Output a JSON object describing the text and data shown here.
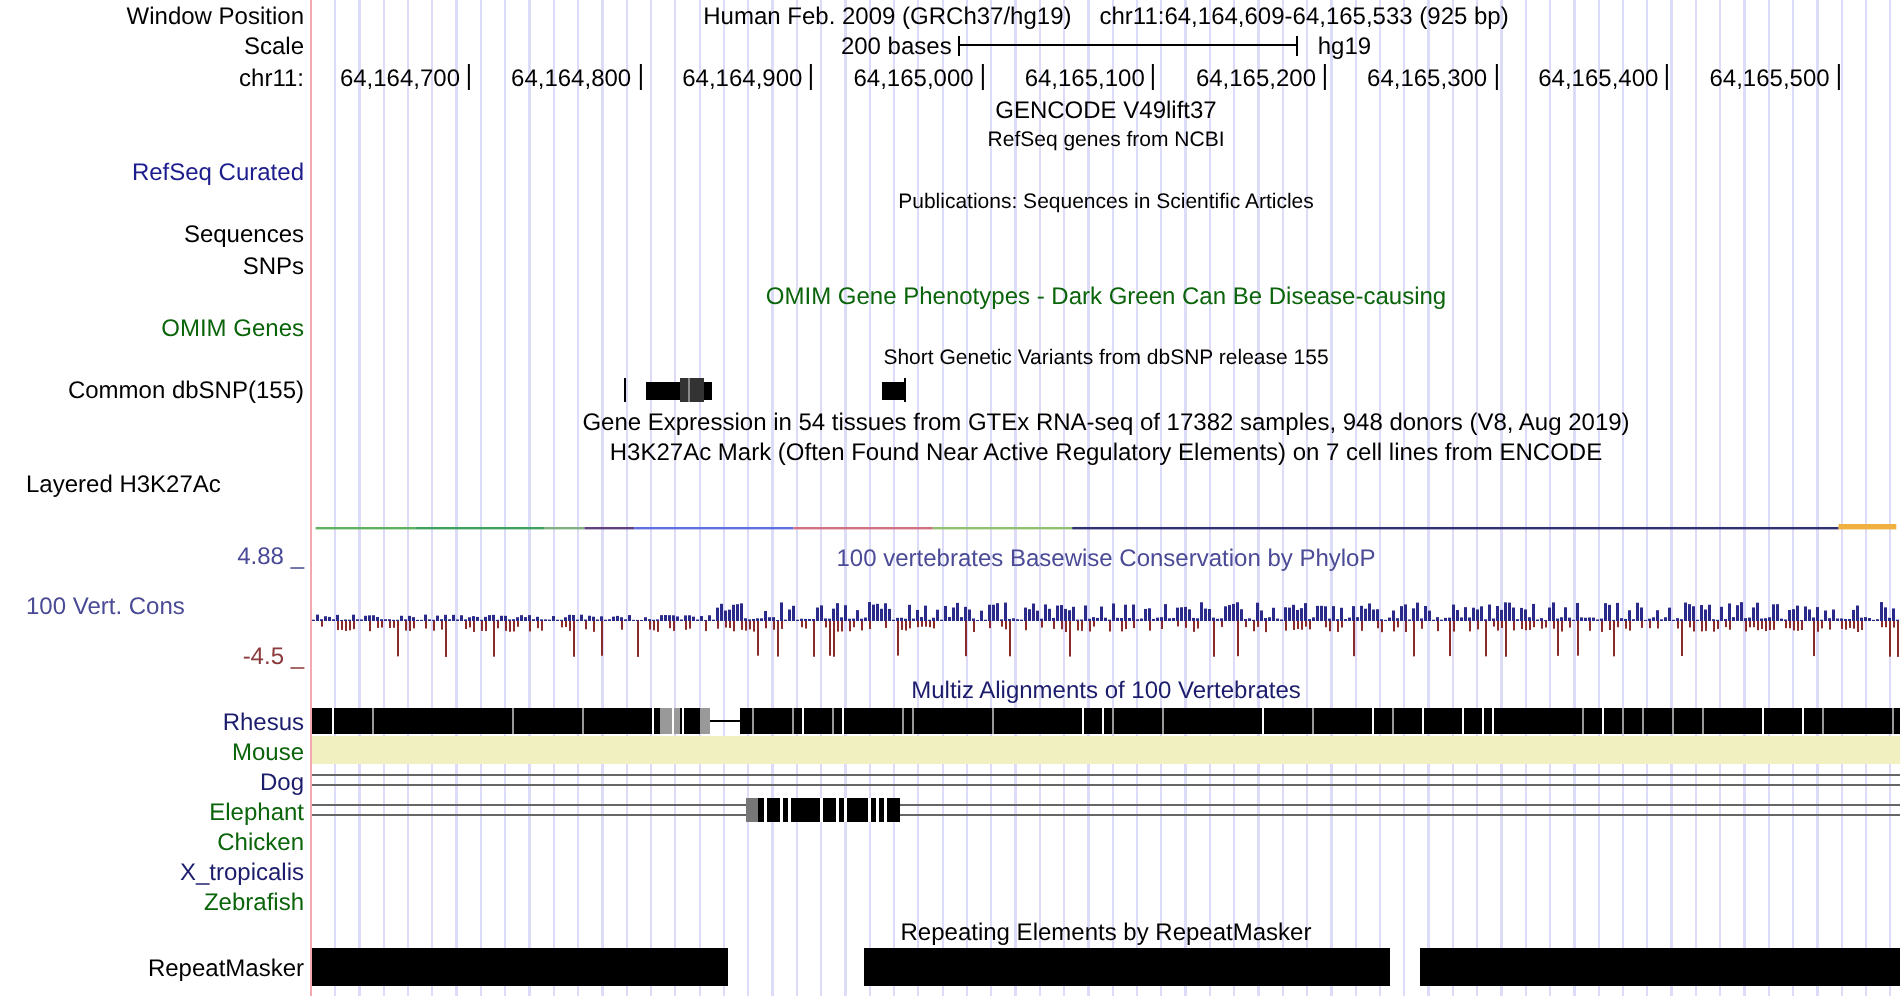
{
  "rows": [
    {
      "kind": "position",
      "label": "Window Position",
      "assembly": "Human Feb. 2009 (GRCh37/hg19)",
      "position": "chr11:64,164,609-64,165,533 (925 bp)"
    },
    {
      "kind": "scale",
      "label": "Scale",
      "span": "200 bases",
      "database": "hg19"
    },
    {
      "kind": "ruler",
      "label": "chr11:",
      "ticks": [
        "64,164,700",
        "64,164,800",
        "64,164,900",
        "64,165,000",
        "64,165,100",
        "64,165,200",
        "64,165,300",
        "64,165,400",
        "64,165,500"
      ]
    },
    {
      "kind": "title",
      "title": "GENCODE V49lift37",
      "color": "#000000"
    },
    {
      "kind": "subtitle",
      "title": "RefSeq genes from NCBI",
      "color": "#000000"
    },
    {
      "kind": "label",
      "label": "RefSeq Curated",
      "color": "#1c1c8c"
    },
    {
      "kind": "subtitle",
      "title": "Publications: Sequences in Scientific Articles",
      "color": "#000000"
    },
    {
      "kind": "label",
      "label": "Sequences",
      "color": "#000000"
    },
    {
      "kind": "label",
      "label": "SNPs",
      "color": "#000000"
    },
    {
      "kind": "title",
      "title": "OMIM Gene Phenotypes - Dark Green Can Be Disease-causing",
      "color": "#0a640a"
    },
    {
      "kind": "label",
      "label": "OMIM Genes",
      "color": "#0a640a"
    },
    {
      "kind": "subtitle",
      "title": "Short Genetic Variants from dbSNP release 155",
      "color": "#000000"
    },
    {
      "kind": "snps",
      "label": "Common dbSNP(155)"
    },
    {
      "kind": "title",
      "title": "Gene Expression in 54 tissues from GTEx RNA-seq of 17382 samples, 948 donors (V8, Aug 2019)",
      "color": "#000000"
    },
    {
      "kind": "title",
      "title": "H3K27Ac Mark (Often Found Near Active Regulatory Elements) on 7 cell lines from ENCODE",
      "color": "#000000"
    },
    {
      "kind": "left_label",
      "label": "Layered H3K27Ac"
    },
    {
      "kind": "signal"
    },
    {
      "kind": "conservation",
      "title": "100 vertebrates Basewise Conservation by PhyloP",
      "label": "100 Vert. Cons",
      "max": "4.88 _",
      "min": "-4.5 _"
    },
    {
      "kind": "title",
      "title": "Multiz Alignments of 100 Vertebrates",
      "color": "#1c1c6c"
    },
    {
      "kind": "blocks",
      "label": "Rhesus",
      "color": "#1c1c6c"
    },
    {
      "kind": "shade",
      "label": "Mouse",
      "color": "#0a640a"
    },
    {
      "kind": "lines",
      "label": "Dog",
      "color": "#1c1c6c"
    },
    {
      "kind": "lines_blocks",
      "label": "Elephant",
      "color": "#0a640a"
    },
    {
      "kind": "empty",
      "label": "Chicken",
      "color": "#0a640a"
    },
    {
      "kind": "empty",
      "label": "X_tropicalis",
      "color": "#1c1c6c"
    },
    {
      "kind": "empty",
      "label": "Zebrafish",
      "color": "#0a640a"
    },
    {
      "kind": "title",
      "title": "Repeating Elements by RepeatMasker",
      "color": "#000000"
    },
    {
      "kind": "repeats",
      "label": "RepeatMasker"
    }
  ]
}
